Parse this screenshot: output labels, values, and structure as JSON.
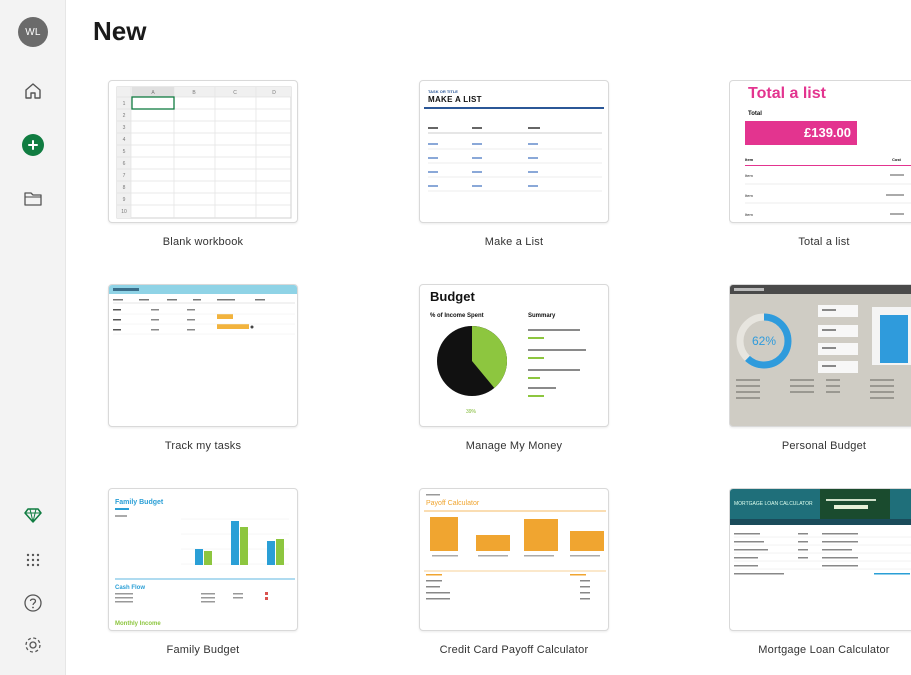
{
  "rail": {
    "avatar_initials": "WL",
    "items": [
      {
        "name": "home-icon"
      },
      {
        "name": "create-new-icon"
      },
      {
        "name": "open-folder-icon"
      },
      {
        "name": "premium-diamond-icon"
      },
      {
        "name": "app-launcher-icon"
      },
      {
        "name": "help-icon"
      },
      {
        "name": "settings-icon"
      }
    ]
  },
  "page": {
    "title": "New"
  },
  "templates": [
    {
      "label": "Blank workbook"
    },
    {
      "label": "Make a List"
    },
    {
      "label": "Total a list"
    },
    {
      "label": "Track my tasks"
    },
    {
      "label": "Manage My Money"
    },
    {
      "label": "Personal Budget"
    },
    {
      "label": "Family Budget"
    },
    {
      "label": "Credit Card Payoff Calculator"
    },
    {
      "label": "Mortgage Loan Calculator"
    }
  ],
  "previews": {
    "blank": {
      "columns": [
        "A",
        "B",
        "C",
        "D"
      ],
      "rows": [
        "1",
        "2",
        "3",
        "4",
        "5",
        "6",
        "7",
        "8",
        "9",
        "10"
      ]
    },
    "make_list": {
      "small": "TASK OR TITLE",
      "big": "MAKE A LIST"
    },
    "total_list": {
      "title": "Total a list",
      "total_label": "Total",
      "amount": "£139.00",
      "col_item": "Item",
      "col_cost": "Cost",
      "rows": [
        "Item",
        "Item",
        "Item"
      ]
    },
    "money": {
      "title": "Budget",
      "subtitle": "% of Income Spent",
      "summary": "Summary",
      "percent": "39%",
      "pie_fraction": 0.39
    },
    "personal": {
      "percent": "62%",
      "gauge_fraction": 0.62
    },
    "family": {
      "title": "Family Budget",
      "cash_flow": "Cash Flow",
      "monthly_income": "Monthly Income"
    },
    "credit": {
      "title": "Payoff Calculator"
    },
    "mortgage": {
      "title": "MORTGAGE LOAN CALCULATOR"
    }
  },
  "colors": {
    "excel_green": "#107c41",
    "accent_pink": "#e3348f",
    "budget_green": "#8dc63f",
    "orange": "#f0a530",
    "teal": "#1f6f7a"
  }
}
